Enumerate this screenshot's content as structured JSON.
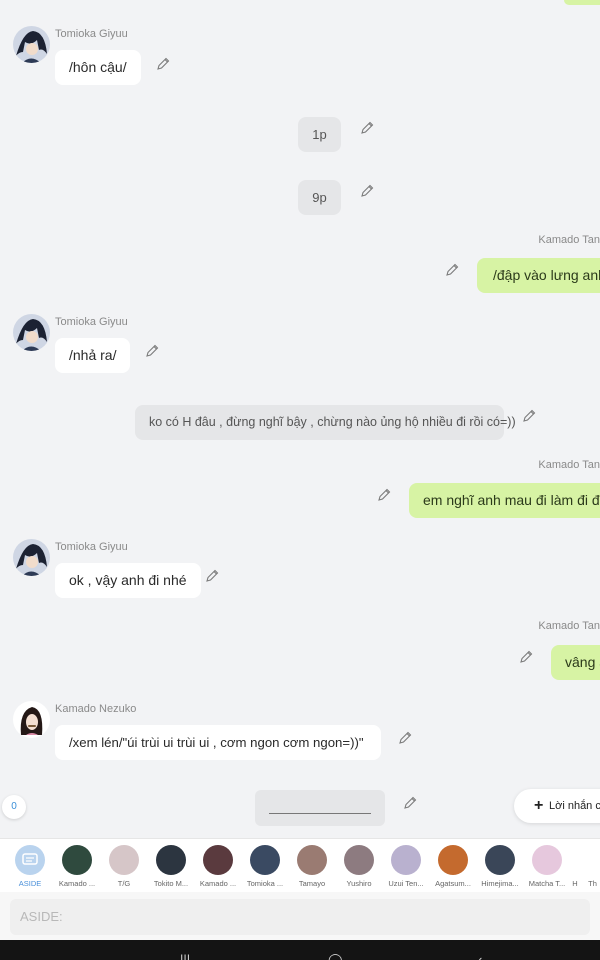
{
  "chat": {
    "messages": [
      {
        "sender": "Tomioka Giyuu",
        "text": "/hôn cậu/"
      },
      {
        "text": "1p"
      },
      {
        "text": "9p"
      },
      {
        "sender": "Kamado Tan",
        "text": "/đập vào lưng anh./"
      },
      {
        "sender": "Tomioka Giyuu",
        "text": "/nhả ra/"
      },
      {
        "text": "ko có H đâu , đừng nghĩ bậy , chừng nào ủng hộ nhiều đi rồi có=))"
      },
      {
        "sender": "Kamado Tan",
        "text": "em nghĩ anh mau đi làm đi đấy"
      },
      {
        "sender": "Tomioka Giyuu",
        "text": "ok , vậy anh đi nhé"
      },
      {
        "sender": "Kamado Tan",
        "text": "vâng a"
      },
      {
        "sender": "Kamado Nezuko",
        "text": "/xem lén/\"úi trùi ui trùi ui , cơm ngon cơm ngon=))\""
      }
    ]
  },
  "counter": "0",
  "note_button": {
    "label": "Lời nhắn củ"
  },
  "characters": [
    {
      "name": "ASIDE",
      "color": "#b9d3ee"
    },
    {
      "name": "Kamado ...",
      "color": "#2f4a3e"
    },
    {
      "name": "T/G",
      "color": "#d6c6c8"
    },
    {
      "name": "Tokito M...",
      "color": "#2c3540"
    },
    {
      "name": "Kamado ...",
      "color": "#5a3a3e"
    },
    {
      "name": "Tomioka ...",
      "color": "#3a4a62"
    },
    {
      "name": "Tamayo",
      "color": "#9a7b72"
    },
    {
      "name": "Yushiro",
      "color": "#8d7b80"
    },
    {
      "name": "Uzui Ten...",
      "color": "#b9b1cf"
    },
    {
      "name": "Agatsum...",
      "color": "#c46a2e"
    },
    {
      "name": "Himejima...",
      "color": "#3a4658"
    },
    {
      "name": "Matcha T...",
      "color": "#e6c8dd"
    },
    {
      "name": "H",
      "color": "#ffffff"
    },
    {
      "name": "Th",
      "color": "#ffffff"
    }
  ],
  "composer": {
    "placeholder": "ASIDE:"
  },
  "colors": {
    "green_bubble": "#d7f3a4",
    "white_bubble": "#ffffff",
    "gray_bubble": "#e5e6e8",
    "accent": "#4a90d9"
  }
}
